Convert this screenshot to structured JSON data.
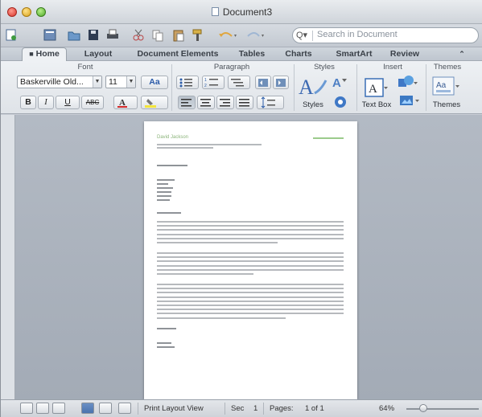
{
  "window": {
    "title": "Document3"
  },
  "search": {
    "placeholder": "Search in Document",
    "button_label": "Q▾"
  },
  "tabs": [
    {
      "label": "Home",
      "active": true
    },
    {
      "label": "Layout"
    },
    {
      "label": "Document Elements"
    },
    {
      "label": "Tables"
    },
    {
      "label": "Charts"
    },
    {
      "label": "SmartArt"
    },
    {
      "label": "Review"
    }
  ],
  "ribbon": {
    "groups": {
      "font": "Font",
      "paragraph": "Paragraph",
      "styles": "Styles",
      "insert": "Insert",
      "themes": "Themes"
    },
    "font_name": "Baskerville Old...",
    "font_size": "11",
    "bold": "B",
    "italic": "I",
    "underline": "U",
    "strikethrough": "ABC",
    "styles_button": "Styles",
    "text_box_button": "Text Box",
    "themes_button": "Themes",
    "font_color": "#d42a2a",
    "highlight_color": "#f3e43a"
  },
  "document": {
    "author_name": "David Jackson",
    "accent_color": "#8bb47a"
  },
  "status": {
    "view": "Print Layout View",
    "section_label": "Sec",
    "section_value": "1",
    "pages_label": "Pages:",
    "pages_value": "1 of 1",
    "zoom": "64%"
  }
}
